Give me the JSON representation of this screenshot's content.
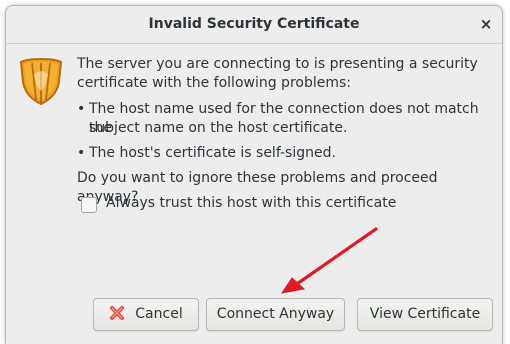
{
  "dialog": {
    "title": "Invalid Security Certificate",
    "close_label": "×",
    "intro": [
      "The server you are connecting to is presenting a security",
      "certificate with the following problems:"
    ],
    "problems": [
      {
        "bullet": "•",
        "lines": [
          "The host name used for the connection does not match the",
          "subject name on the host certificate."
        ]
      },
      {
        "bullet": "•",
        "lines": [
          "The host's certificate is self-signed."
        ]
      }
    ],
    "question": "Do you want to ignore these problems and proceed anyway?",
    "checkbox_label": "Always trust this host with this certificate",
    "checkbox_checked": false,
    "buttons": {
      "cancel": "Cancel",
      "connect": "Connect Anyway",
      "view": "View Certificate"
    },
    "icons": {
      "warning": "shield-warning-icon",
      "cancel": "red-x-icon",
      "annotation": "red-arrow-annotation"
    },
    "colors": {
      "shield": "#f2a322",
      "cancel_x": "#e8493d",
      "annotation_arrow": "#e01b24"
    }
  }
}
